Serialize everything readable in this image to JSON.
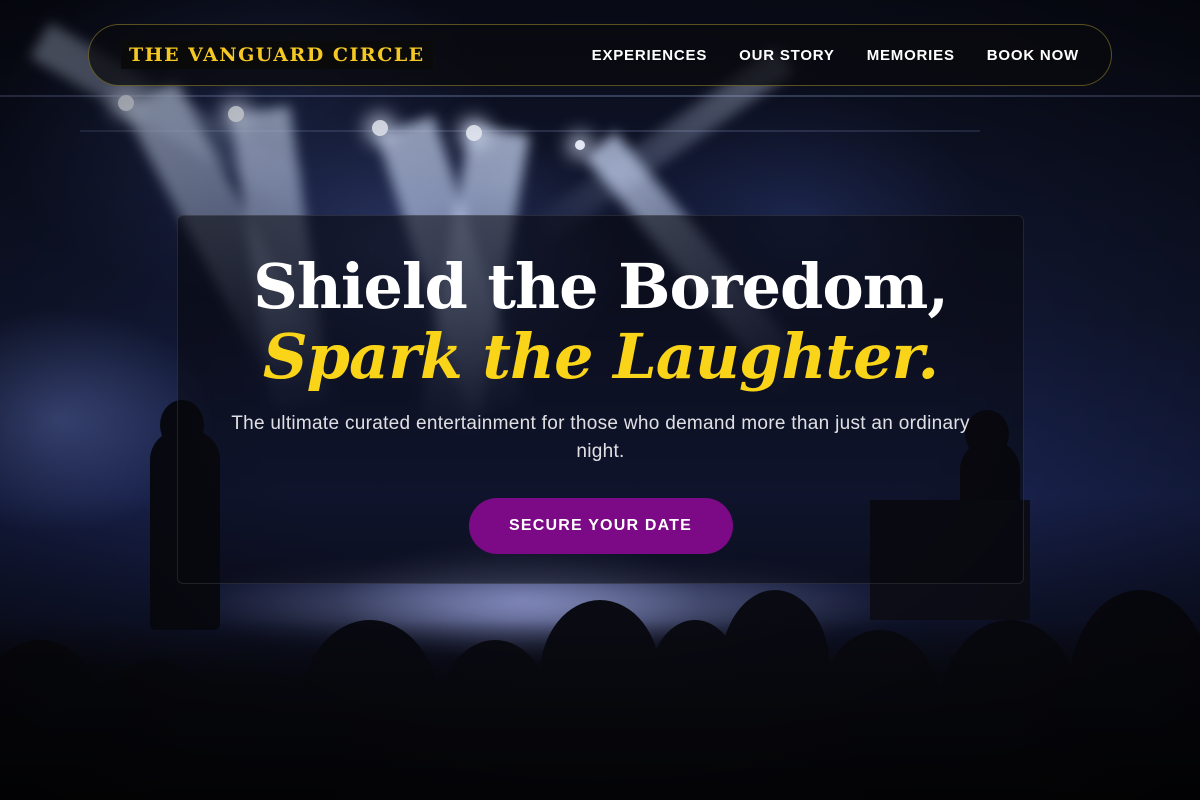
{
  "brand": {
    "name": "THE VANGUARD CIRCLE"
  },
  "nav": {
    "items": [
      {
        "label": "EXPERIENCES"
      },
      {
        "label": "OUR STORY"
      },
      {
        "label": "MEMORIES"
      },
      {
        "label": "BOOK NOW"
      }
    ]
  },
  "hero": {
    "title_line1": "Shield the Boredom,",
    "title_line2": "Spark the Laughter.",
    "subtitle": "The ultimate curated entertainment for those who demand more than just an ordinary night.",
    "cta_label": "SECURE YOUR DATE"
  },
  "colors": {
    "accent_gold": "#f9d418",
    "cta_purple": "#7c0a86",
    "nav_border": "#f0d23c"
  },
  "background": {
    "image_subject": "concert-crowd-stage-lights"
  }
}
